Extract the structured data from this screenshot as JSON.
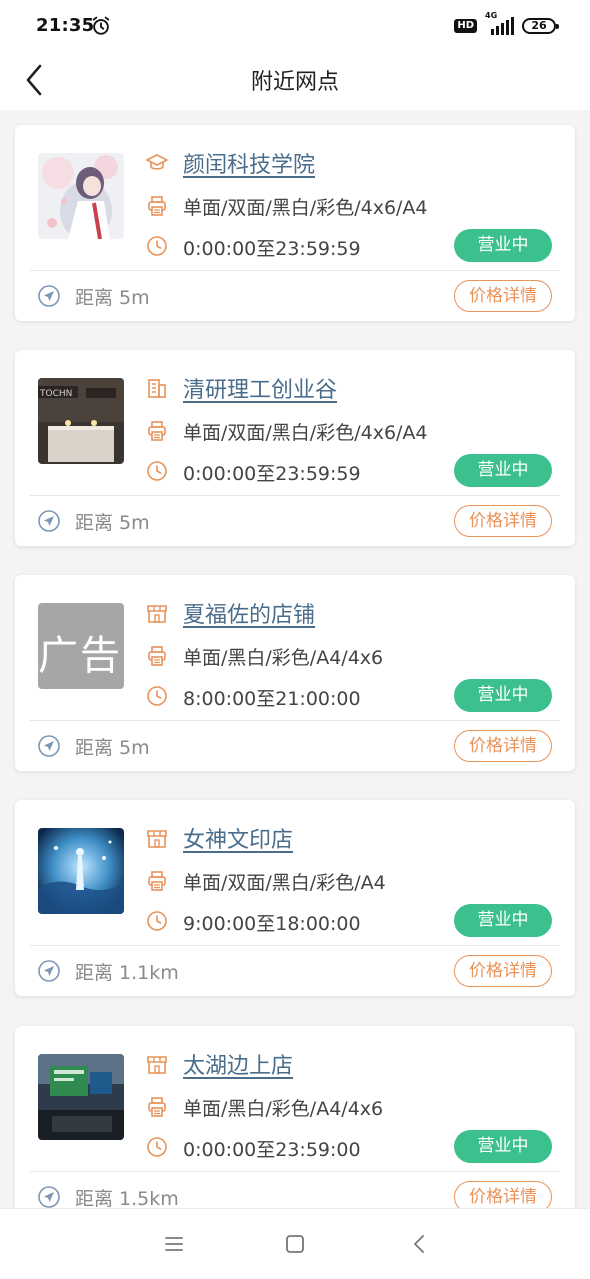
{
  "status_bar": {
    "time": "21:35",
    "hd": "HD",
    "network": "4G",
    "battery": "26"
  },
  "header": {
    "title": "附近网点"
  },
  "shops": [
    {
      "name": "颜闰科技学院",
      "name_icon": "graduation-cap-icon",
      "services": "单面/双面/黑白/彩色/4x6/A4",
      "hours": "0:00:00至23:59:59",
      "status": "营业中",
      "distance": "距离 5m",
      "price_label": "价格详情",
      "thumb": "anime-girl-thumbnail"
    },
    {
      "name": "清研理工创业谷",
      "name_icon": "building-icon",
      "services": "单面/双面/黑白/彩色/4x6/A4",
      "hours": "0:00:00至23:59:59",
      "status": "营业中",
      "distance": "距离 5m",
      "price_label": "价格详情",
      "thumb": "office-reception-thumbnail"
    },
    {
      "name": "夏福佐的店铺",
      "name_icon": "store-icon",
      "services": "单面/黑白/彩色/A4/4x6",
      "hours": "8:00:00至21:00:00",
      "status": "营业中",
      "distance": "距离 5m",
      "price_label": "价格详情",
      "thumb": "ad-placeholder-thumbnail",
      "thumb_text": "广告"
    },
    {
      "name": "女神文印店",
      "name_icon": "store-icon",
      "services": "单面/双面/黑白/彩色/A4",
      "hours": "9:00:00至18:00:00",
      "status": "营业中",
      "distance": "距离 1.1km",
      "price_label": "价格详情",
      "thumb": "blue-fantasy-thumbnail"
    },
    {
      "name": "太湖边上店",
      "name_icon": "store-icon",
      "services": "单面/黑白/彩色/A4/4x6",
      "hours": "0:00:00至23:59:00",
      "status": "营业中",
      "distance": "距离 1.5km",
      "price_label": "价格详情",
      "thumb": "print-kiosk-thumbnail"
    }
  ],
  "colors": {
    "accent_orange": "#e8935a",
    "status_green": "#3cc18e",
    "link_blue": "#4a6d8c",
    "nav_icon_blue": "#7d97b3",
    "background": "#f4f4f4"
  },
  "navbar": {
    "icons": [
      "menu-icon",
      "home-icon",
      "back-icon"
    ]
  }
}
